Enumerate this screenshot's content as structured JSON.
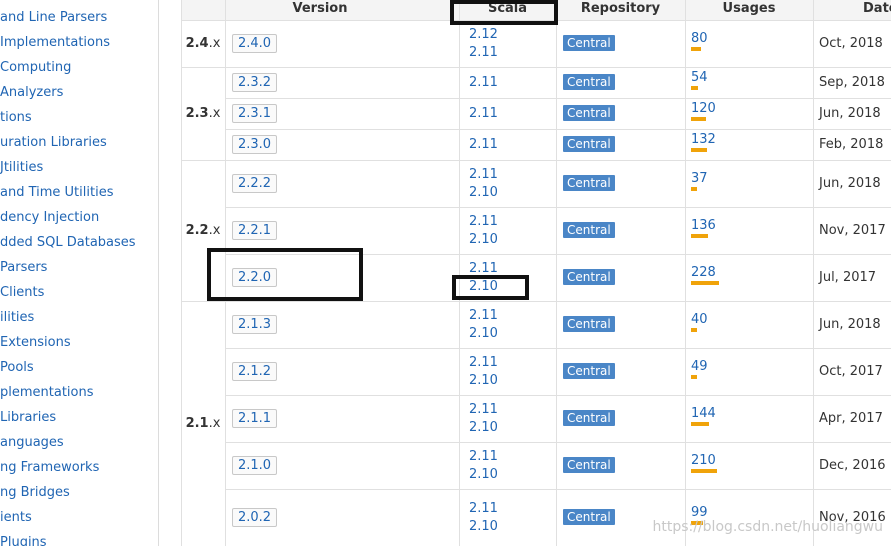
{
  "sidebar": {
    "items": [
      {
        "label": "and Line Parsers"
      },
      {
        "label": " Implementations"
      },
      {
        "label": "Computing"
      },
      {
        "label": "Analyzers"
      },
      {
        "label": "tions"
      },
      {
        "label": "uration Libraries"
      },
      {
        "label": "Jtilities"
      },
      {
        "label": "and Time Utilities"
      },
      {
        "label": "dency Injection"
      },
      {
        "label": "dded SQL Databases"
      },
      {
        "label": "Parsers"
      },
      {
        "label": "Clients"
      },
      {
        "label": "ilities"
      },
      {
        "label": "Extensions"
      },
      {
        "label": "Pools"
      },
      {
        "label": "plementations"
      },
      {
        "label": "Libraries"
      },
      {
        "label": "anguages"
      },
      {
        "label": "ng Frameworks"
      },
      {
        "label": "ng Bridges"
      },
      {
        "label": "ients"
      },
      {
        "label": " Plugins"
      }
    ]
  },
  "table": {
    "headers": {
      "version": "Version",
      "scala": "Scala",
      "repository": "Repository",
      "usages": "Usages",
      "date": "Date"
    },
    "groups": [
      {
        "major": "2.4",
        "suffix": ".x"
      },
      {
        "major": "2.3",
        "suffix": ".x"
      },
      {
        "major": "2.2",
        "suffix": ".x"
      },
      {
        "major": "2.1",
        "suffix": ".x"
      }
    ],
    "rows": [
      {
        "version": "2.4.0",
        "scala": [
          "2.12",
          "2.11"
        ],
        "repo": "Central",
        "usages": "80",
        "usage_level": 0.35,
        "date": "Oct, 2018"
      },
      {
        "version": "2.3.2",
        "scala": [
          "2.11"
        ],
        "repo": "Central",
        "usages": "54",
        "usage_level": 0.24,
        "date": "Sep, 2018"
      },
      {
        "version": "2.3.1",
        "scala": [
          "2.11"
        ],
        "repo": "Central",
        "usages": "120",
        "usage_level": 0.53,
        "date": "Jun, 2018"
      },
      {
        "version": "2.3.0",
        "scala": [
          "2.11"
        ],
        "repo": "Central",
        "usages": "132",
        "usage_level": 0.58,
        "date": "Feb, 2018"
      },
      {
        "version": "2.2.2",
        "scala": [
          "2.11",
          "2.10"
        ],
        "repo": "Central",
        "usages": "37",
        "usage_level": 0.16,
        "date": "Jun, 2018"
      },
      {
        "version": "2.2.1",
        "scala": [
          "2.11",
          "2.10"
        ],
        "repo": "Central",
        "usages": "136",
        "usage_level": 0.6,
        "date": "Nov, 2017"
      },
      {
        "version": "2.2.0",
        "scala": [
          "2.11",
          "2.10"
        ],
        "repo": "Central",
        "usages": "228",
        "usage_level": 1.0,
        "date": "Jul, 2017"
      },
      {
        "version": "2.1.3",
        "scala": [
          "2.11",
          "2.10"
        ],
        "repo": "Central",
        "usages": "40",
        "usage_level": 0.18,
        "date": "Jun, 2018"
      },
      {
        "version": "2.1.2",
        "scala": [
          "2.11",
          "2.10"
        ],
        "repo": "Central",
        "usages": "49",
        "usage_level": 0.21,
        "date": "Oct, 2017"
      },
      {
        "version": "2.1.1",
        "scala": [
          "2.11",
          "2.10"
        ],
        "repo": "Central",
        "usages": "144",
        "usage_level": 0.63,
        "date": "Apr, 2017"
      },
      {
        "version": "2.1.0",
        "scala": [
          "2.11",
          "2.10"
        ],
        "repo": "Central",
        "usages": "210",
        "usage_level": 0.92,
        "date": "Dec, 2016"
      },
      {
        "version": "2.0.2",
        "scala": [
          "2.11",
          "2.10"
        ],
        "repo": "Central",
        "usages": "99",
        "usage_level": 0.43,
        "date": "Nov, 2016"
      }
    ]
  },
  "watermark": "https://blog.csdn.net/huoliangwu",
  "colors": {
    "link": "#2065b3",
    "badge": "#4a86c7",
    "usage_bar": "#f0a30a",
    "highlight_box": "#111111"
  }
}
